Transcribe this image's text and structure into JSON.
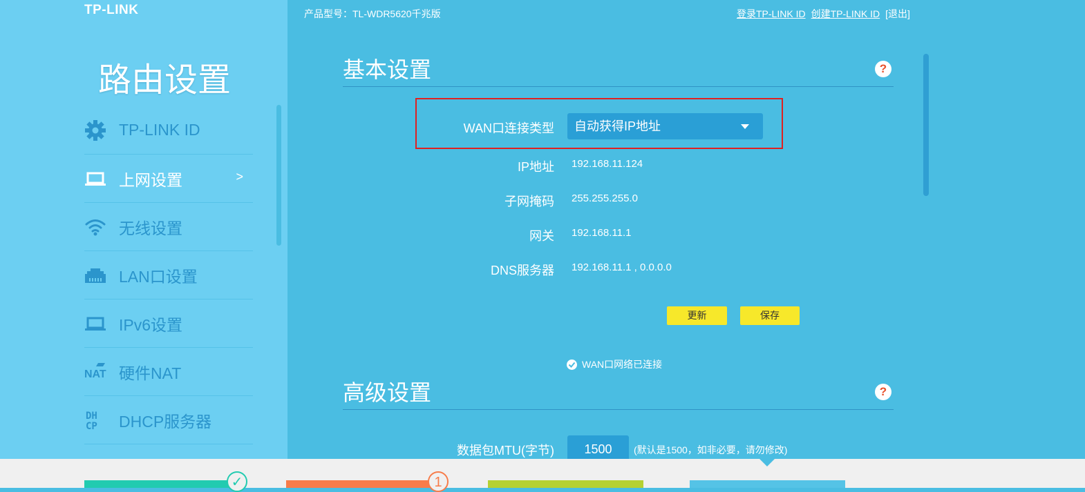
{
  "header": {
    "logo": "TP-LINK",
    "model_label": "产品型号：TL-WDR5620千兆版",
    "login_link": "登录TP-LINK ID",
    "create_link": "创建TP-LINK ID",
    "logout_link": "[退出]"
  },
  "sidebar": {
    "title": "路由设置",
    "items": [
      {
        "label": "TP-LINK ID",
        "icon": "gear-icon"
      },
      {
        "label": "上网设置",
        "icon": "laptop-icon",
        "active": true,
        "arrow": ">"
      },
      {
        "label": "无线设置",
        "icon": "wifi-icon"
      },
      {
        "label": "LAN口设置",
        "icon": "lan-port-icon"
      },
      {
        "label": "IPv6设置",
        "icon": "laptop-icon"
      },
      {
        "label": "硬件NAT",
        "icon": "nat-icon"
      },
      {
        "label": "DHCP服务器",
        "icon": "dhcp-icon"
      }
    ]
  },
  "basic": {
    "title": "基本设置",
    "help": "?",
    "wan_type_label": "WAN口连接类型",
    "wan_type_value": "自动获得IP地址",
    "ip_label": "IP地址",
    "ip_value": "192.168.11.124",
    "mask_label": "子网掩码",
    "mask_value": "255.255.255.0",
    "gateway_label": "网关",
    "gateway_value": "192.168.11.1",
    "dns_label": "DNS服务器",
    "dns_value": "192.168.11.1 , 0.0.0.0",
    "refresh_button": "更新",
    "save_button": "保存",
    "status_text": "WAN口网络已连接"
  },
  "advanced": {
    "title": "高级设置",
    "help": "?",
    "mtu_label": "数据包MTU(字节)",
    "mtu_value": "1500",
    "mtu_hint": "(默认是1500，如非必要，请勿修改)"
  },
  "bottom_tabs": [
    {
      "color": "#22cbb0",
      "badge": "✓"
    },
    {
      "color": "#f77c4a",
      "badge": "1"
    },
    {
      "color": "#b5d132"
    },
    {
      "color": "#55c3e6"
    }
  ],
  "colors": {
    "sidebar_bg": "#6ccff2",
    "main_bg": "#4abde2",
    "button_yellow": "#f7e82a",
    "highlight_red": "#e02020"
  }
}
